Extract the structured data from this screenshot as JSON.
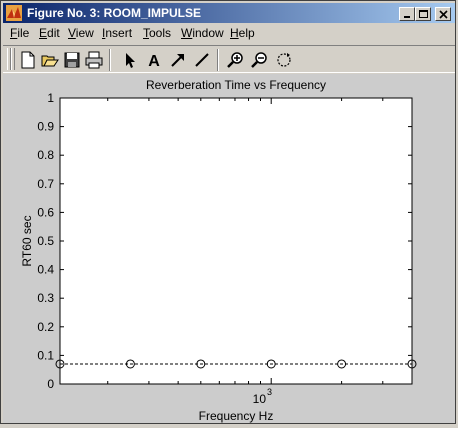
{
  "window": {
    "title": "Figure No. 3: ROOM_IMPULSE"
  },
  "menu": [
    {
      "letter": "F",
      "rest": "ile"
    },
    {
      "letter": "E",
      "rest": "dit"
    },
    {
      "letter": "V",
      "rest": "iew"
    },
    {
      "letter": "I",
      "rest": "nsert"
    },
    {
      "letter": "T",
      "rest": "ools"
    },
    {
      "letter": "W",
      "rest": "indow"
    },
    {
      "letter": "H",
      "rest": "elp"
    }
  ],
  "toolbar": {
    "buttons": [
      "new-figure-icon",
      "open-file-icon",
      "save-icon",
      "print-icon",
      "edit-plot-arrow-icon",
      "insert-text-icon",
      "insert-arrow-icon",
      "insert-line-icon",
      "zoom-in-icon",
      "zoom-out-icon",
      "rotate-3d-icon"
    ],
    "text_tool_label": "A"
  },
  "colors": {
    "title_bar_start": "#0a246a",
    "title_bar_end": "#a6caf0",
    "figure_background": "#cccccc",
    "axes_background": "#ffffff"
  },
  "chart_data": {
    "type": "line",
    "title": "Reverberation Time vs Frequency",
    "xlabel": "Frequency Hz",
    "ylabel": "RT60 sec",
    "xscale": "log",
    "xlim": [
      125,
      4000
    ],
    "ylim": [
      0,
      1
    ],
    "yticks": [
      "0",
      "0.1",
      "0.2",
      "0.3",
      "0.4",
      "0.5",
      "0.6",
      "0.7",
      "0.8",
      "0.9",
      "1"
    ],
    "xtick_label_base": "10",
    "xtick_label_exponent": "3",
    "grid": false,
    "line_style": "dashed",
    "marker": "circle",
    "x": [
      125,
      250,
      500,
      1000,
      2000,
      4000
    ],
    "y": [
      0.07,
      0.07,
      0.07,
      0.07,
      0.07,
      0.07
    ]
  }
}
